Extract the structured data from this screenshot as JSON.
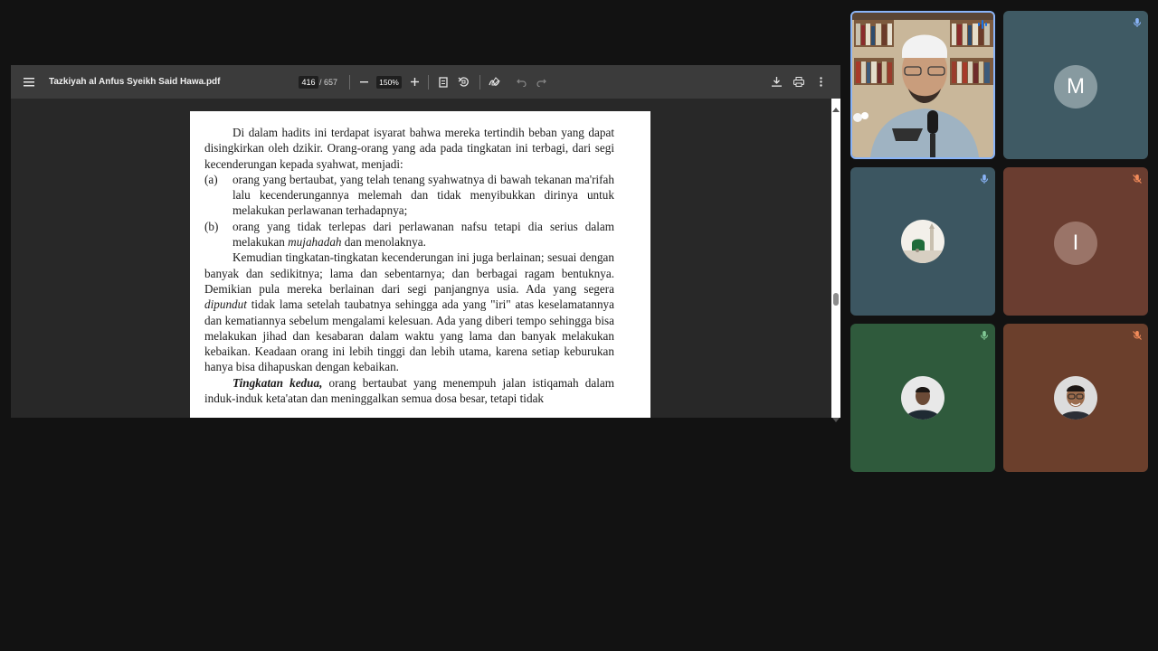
{
  "viewer": {
    "title": "Tazkiyah al Anfus Syeikh Said Hawa.pdf",
    "current_page": "416",
    "total_pages": "/ 657",
    "zoom": "150%",
    "icons": [
      "menu-icon",
      "zoom-out-icon",
      "zoom-in-icon",
      "fit-page-icon",
      "rotate-icon",
      "annotate-icon",
      "undo-icon",
      "redo-icon",
      "download-icon",
      "print-icon",
      "more-vert-icon"
    ]
  },
  "document": {
    "para1": "Di dalam hadits ini terdapat isyarat bahwa mereka tertindih beban yang dapat disingkirkan oleh dzikir. Orang-orang yang ada pada tingkatan ini terbagi, dari segi kecenderungan kepada syahwat, menjadi:",
    "item_a_label": "(a)",
    "item_a_text": "orang yang bertaubat, yang telah tenang syahwatnya di bawah tekanan ma'rifah lalu kecenderungannya melemah dan tidak menyibukkan dirinya untuk melakukan perlawanan terhadapnya;",
    "item_b_label": "(b)",
    "item_b_text_1": "orang yang tidak terlepas dari perlawanan nafsu tetapi dia serius dalam melakukan ",
    "item_b_italic": "mujahadah",
    "item_b_text_2": " dan menolaknya.",
    "para2_1": "Kemudian tingkatan-tingkatan kecenderungan ini juga berlainan; sesuai dengan banyak dan sedikitnya; lama dan sebentarnya; dan berbagai ragam bentuknya. Demikian pula mereka berlainan dari segi panjangnya usia. Ada yang segera ",
    "para2_italic": "dipundut",
    "para2_2": " tidak lama setelah taubatnya sehingga ada yang \"iri\" atas keselamatannya dan kematiannya sebelum mengalami kelesuan. Ada yang diberi tempo sehingga bisa melakukan jihad dan kesabaran dalam waktu yang lama dan banyak melakukan kebaikan. Keadaan orang ini lebih tinggi dan lebih utama, karena setiap keburukan hanya bisa dihapuskan dengan kebaikan.",
    "para3_bold_italic": "Tingkatan kedua,",
    "para3_text": " orang bertaubat yang menempuh jalan istiqamah dalam induk-induk keta'atan dan meninggalkan semua dosa besar, tetapi tidak"
  },
  "participants": [
    {
      "type": "video",
      "mic": "speaking",
      "accent": "#8ab4f8"
    },
    {
      "type": "letter",
      "initial": "M",
      "mic": "on",
      "bg": "#3f5a64"
    },
    {
      "type": "photo",
      "photo": "mosque",
      "mic": "on",
      "bg": "#3c5661"
    },
    {
      "type": "letter",
      "initial": "I",
      "mic": "muted",
      "bg": "#6a3d30"
    },
    {
      "type": "photo",
      "photo": "man",
      "mic": "on",
      "bg": "#2f5a3c"
    },
    {
      "type": "photo",
      "photo": "man-glasses",
      "mic": "muted",
      "bg": "#6b3f2c"
    }
  ]
}
